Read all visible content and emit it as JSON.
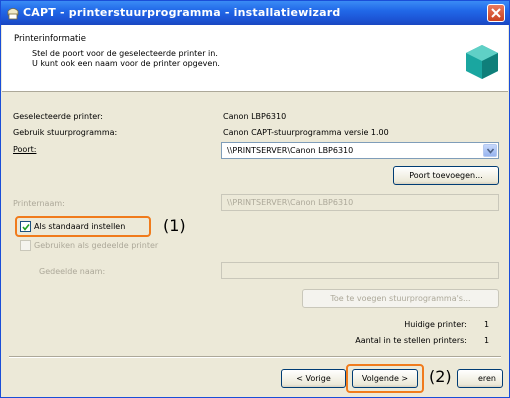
{
  "window": {
    "title": "CAPT - printerstuurprogramma - installatiewizard"
  },
  "header": {
    "title": "Printerinformatie",
    "desc_line1": "Stel de poort voor de geselecteerde printer in.",
    "desc_line2": "U kunt ook een naam voor de printer opgeven."
  },
  "info": {
    "selected_label": "Geselecteerde printer:",
    "selected_value": "Canon LBP6310",
    "driver_label": "Gebruik stuurprogramma:",
    "driver_value": "Canon CAPT-stuurprogramma versie 1.00",
    "port_label": "Poort:",
    "port_value": "\\\\PRINTSERVER\\Canon LBP6310"
  },
  "buttons": {
    "add_port": "Poort toevoegen...",
    "add_drivers": "Toe te voegen stuurprogramma's...",
    "back": "< Vorige",
    "next": "Volgende >",
    "cancel": "eren"
  },
  "printer_name": {
    "label": "Printernaam:",
    "value": "\\\\PRINTSERVER\\Canon LBP6310"
  },
  "options": {
    "default_label": "Als standaard instellen",
    "default_checked": true,
    "shared_label": "Gebruiken als gedeelde printer",
    "shared_checked": false,
    "share_name_label": "Gedeelde naam:"
  },
  "counts": {
    "current_label": "Huidige printer:",
    "current_value": "1",
    "total_label": "Aantal in te stellen printers:",
    "total_value": "1"
  },
  "annotations": {
    "one": "(1)",
    "two": "(2)"
  },
  "colors": {
    "titlebar": "#2168e8",
    "highlight": "#f07b1c",
    "dialog": "#ece9d8"
  }
}
